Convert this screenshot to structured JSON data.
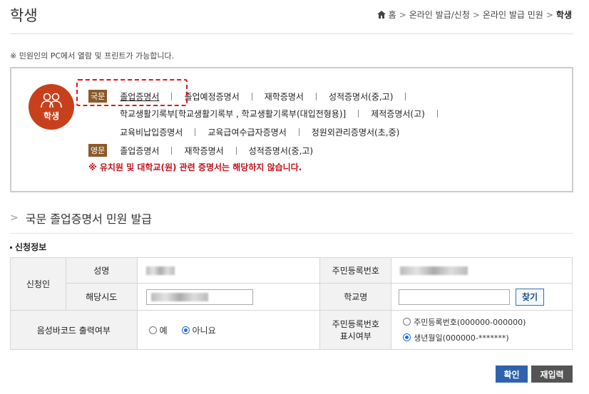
{
  "header": {
    "title": "학생",
    "breadcrumb": [
      "홈",
      "온라인 발급/신청",
      "온라인 발급 민원",
      "학생"
    ]
  },
  "notice": "※ 민원인의 PC에서 열람 및 프린트가 가능합니다.",
  "category": {
    "label": "학생",
    "domestic_tag": "국문",
    "domestic_row1": [
      "졸업증명서",
      "졸업예정증명서",
      "재학증명서",
      "성적증명서(중,고)"
    ],
    "domestic_row2": [
      "학교생활기록부[학교생활기록부 , 학교생활기록부(대입전형용)]",
      "제적증명서(고)"
    ],
    "domestic_row3": [
      "교육비납입증명서",
      "교육급여수급자증명서",
      "정원외관리증명서(초,중)"
    ],
    "english_tag": "영문",
    "english_row": [
      "졸업증명서",
      "재학증명서",
      "성적증명서(중,고)"
    ],
    "warning": "※ 유치원 및 대학교(원) 관련 증명서는 해당하지 않습니다."
  },
  "section_title": "국문 졸업증명서 민원 발급",
  "sub_title": "신청정보",
  "form": {
    "applicant": "신청인",
    "name_label": "성명",
    "region_label": "해당시도",
    "rrn_label": "주민등록번호",
    "school_label": "학교명",
    "find_button": "찾기",
    "barcode_label": "음성바코드 출력여부",
    "barcode_yes": "예",
    "barcode_no": "아니요",
    "rrn_display_label_1": "주민등록번호",
    "rrn_display_label_2": "표시여부",
    "rrn_option_full": "주민등록번호(000000-000000)",
    "rrn_option_birth": "생년월일(000000-*******)"
  },
  "buttons": {
    "confirm": "확인",
    "reset": "재입력"
  },
  "colors": {
    "badge": "#c7401b",
    "tag": "#8b5a2b",
    "warning": "#c0141c",
    "primary_button": "#2e62ad"
  }
}
